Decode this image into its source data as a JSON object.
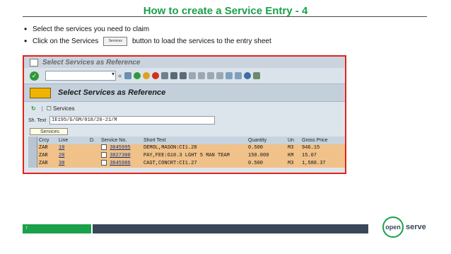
{
  "slide": {
    "title": "How to create a Service Entry - 4",
    "bullets": [
      "Select the services you need to claim",
      {
        "before": "Click on the Services",
        "button_label": "Services",
        "after": "button to load the services to the entry sheet"
      }
    ],
    "page_number": "7"
  },
  "sap": {
    "window_title": "Select Services as Reference",
    "header_title": "Select Services as Reference",
    "services_label": "Services",
    "sh_text_label": "Sh. Text",
    "sh_text_value": "IE195/G/GM/018/20-21/M",
    "tooltip": "Services",
    "columns": [
      "Crcy",
      "Line",
      "D.",
      "Service No.",
      "Short Text",
      "Quantity",
      "Un",
      "Gross Price"
    ],
    "rows": [
      {
        "crcy": "ZAR",
        "line": "10",
        "service_no": "3045995",
        "short_text": "DEMOL,MASON:CI1.28",
        "quantity": "0.500",
        "un": "M3",
        "gross_price": "946.15"
      },
      {
        "crcy": "ZAR",
        "line": "20",
        "service_no": "3027300",
        "short_text": "PAY,FEE:G10.3 LGHT 5 MAN TEAM",
        "quantity": "150.000",
        "un": "KM",
        "gross_price": "15.07"
      },
      {
        "crcy": "ZAR",
        "line": "30",
        "service_no": "3045986",
        "short_text": "CAST,CONCRT:CI1.27",
        "quantity": "0.500",
        "un": "M3",
        "gross_price": "1,588.37"
      }
    ]
  },
  "brand": {
    "logo_mark": "open",
    "logo_word": "serve",
    "green": "#1aa14b",
    "dark": "#3a4759",
    "highlight": "#e2231a"
  }
}
